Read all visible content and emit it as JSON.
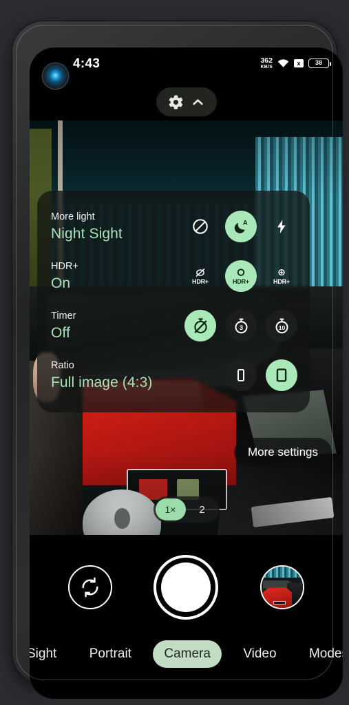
{
  "status_bar": {
    "time": "4:43",
    "net_speed_value": "362",
    "net_speed_unit": "KB/S",
    "sim_label": "x",
    "battery_level": "38",
    "wifi_icon": "wifi-icon"
  },
  "top_controls": {
    "settings_icon": "gear-icon",
    "collapse_icon": "chevron-up-icon"
  },
  "settings_panel": {
    "rows": [
      {
        "label": "More light",
        "value": "Night Sight",
        "options": [
          {
            "name": "night-sight-off",
            "icon": "no-entry-icon",
            "selected": false
          },
          {
            "name": "night-sight-auto",
            "icon": "moon-auto-icon",
            "selected": true
          },
          {
            "name": "flash-on",
            "icon": "flash-icon",
            "selected": false
          }
        ]
      },
      {
        "label": "HDR+",
        "value": "On",
        "options": [
          {
            "name": "hdr-off",
            "icon": "hdr-off-icon",
            "text": "HDR+",
            "selected": false
          },
          {
            "name": "hdr-on",
            "icon": "hdr-on-icon",
            "text": "HDR+",
            "selected": true
          },
          {
            "name": "hdr-enhanced",
            "icon": "hdr-enhanced-icon",
            "text": "HDR+",
            "selected": false
          }
        ]
      },
      {
        "label": "Timer",
        "value": "Off",
        "options": [
          {
            "name": "timer-off",
            "icon": "timer-off-icon",
            "selected": true
          },
          {
            "name": "timer-3s",
            "icon": "timer-3-icon",
            "text": "3",
            "selected": false
          },
          {
            "name": "timer-10s",
            "icon": "timer-10-icon",
            "text": "10",
            "selected": false
          }
        ]
      },
      {
        "label": "Ratio",
        "value": "Full image (4:3)",
        "options": [
          {
            "name": "ratio-16-9",
            "icon": "ratio-tall-icon",
            "selected": false
          },
          {
            "name": "ratio-4-3",
            "icon": "ratio-full-icon",
            "selected": true
          }
        ]
      }
    ]
  },
  "more_settings": {
    "label": "More settings"
  },
  "zoom_selector": {
    "options": [
      {
        "label": "1×",
        "selected": true
      },
      {
        "label": "2",
        "selected": false
      }
    ]
  },
  "bottom_bar": {
    "switch_camera_icon": "switch-camera-icon",
    "shutter_icon": "shutter-icon",
    "gallery_icon": "gallery-thumbnail",
    "modes": [
      {
        "label": "Sight",
        "selected": false,
        "clipped": "left"
      },
      {
        "label": "Portrait",
        "selected": false
      },
      {
        "label": "Camera",
        "selected": true
      },
      {
        "label": "Video",
        "selected": false
      },
      {
        "label": "Modes",
        "selected": false,
        "clipped": "right"
      }
    ]
  },
  "colors": {
    "accent_green": "#a9e8b8",
    "mode_selected": "#c3dcc4",
    "value_text": "#a9e3b9",
    "screen_bg": "#000000",
    "frame_bg": "#2b2c30"
  }
}
